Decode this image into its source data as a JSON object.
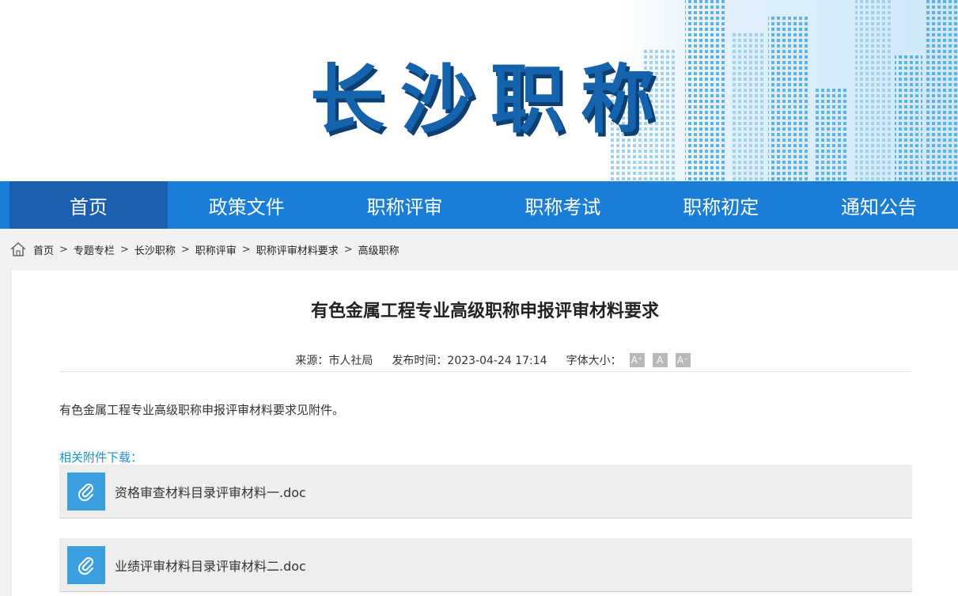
{
  "banner": {
    "title": "长沙职称"
  },
  "nav": {
    "items": [
      {
        "label": "首页",
        "active": true
      },
      {
        "label": "政策文件",
        "active": false
      },
      {
        "label": "职称评审",
        "active": false
      },
      {
        "label": "职称考试",
        "active": false
      },
      {
        "label": "职称初定",
        "active": false
      },
      {
        "label": "通知公告",
        "active": false
      }
    ]
  },
  "breadcrumb": {
    "home_icon": "home-icon",
    "separator": ">",
    "items": [
      "首页",
      "专题专栏",
      "长沙职称",
      "职称评审",
      "职称评审材料要求",
      "高级职称"
    ]
  },
  "article": {
    "title": "有色金属工程专业高级职称申报评审材料要求",
    "source_label": "来源：市人社局",
    "date_label": "发布时间：2023-04-24 17:14",
    "font_size_label": "字体大小：",
    "font_buttons": [
      "A⁺",
      "A",
      "A⁻"
    ],
    "body": "有色金属工程专业高级职称申报评审材料要求见附件。",
    "attachments_heading": "相关附件下载：",
    "attachments": [
      {
        "name": "资格审查材料目录评审材料一.doc",
        "icon": "paperclip-icon"
      },
      {
        "name": "业绩评审材料目录评审材料二.doc",
        "icon": "paperclip-icon"
      }
    ]
  },
  "colors": {
    "nav": "#1a7dd6",
    "nav_active": "#1a5fb0",
    "title_blue": "#1563ac",
    "attachment_icon": "#3aa0e0",
    "link": "#1a93c8"
  }
}
